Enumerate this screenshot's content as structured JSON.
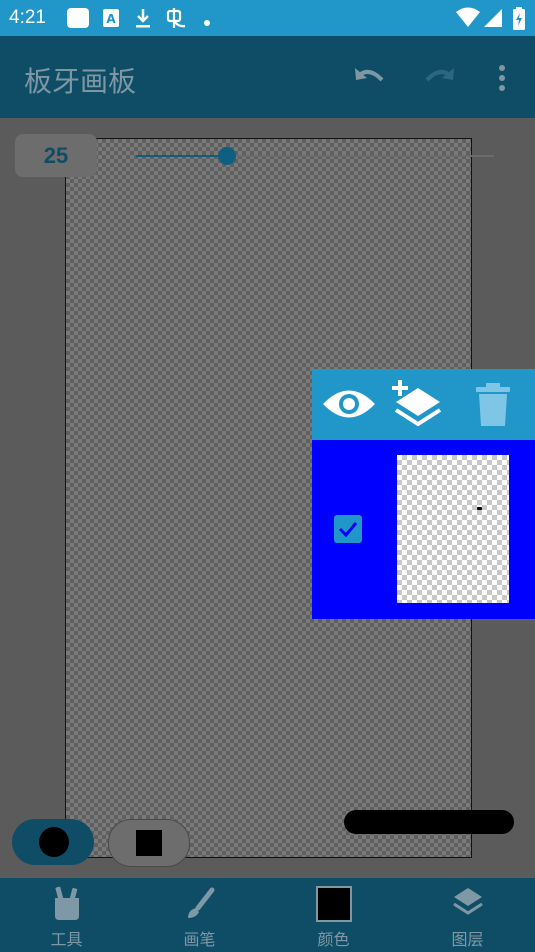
{
  "status_bar": {
    "time": "4:21",
    "icons": [
      "notification-square-icon",
      "font-a-icon",
      "download-icon",
      "bug-icon",
      "dot-icon",
      "wifi-icon",
      "signal-icon",
      "battery-icon"
    ]
  },
  "app_bar": {
    "title": "板牙画板",
    "actions": [
      "undo-icon",
      "redo-icon",
      "more-vert-icon"
    ]
  },
  "brush_size": {
    "value": "25",
    "slider_fraction": 0.255
  },
  "layer_panel": {
    "toolbar": [
      "eye-icon",
      "add-layer-icon",
      "trash-icon"
    ],
    "layers": [
      {
        "visible_checked": true
      }
    ]
  },
  "mode_toggles": [
    {
      "name": "fill-mode",
      "icon": "filled-circle-icon"
    },
    {
      "name": "stroke-mode",
      "icon": "filled-square-icon"
    }
  ],
  "bottom_nav": {
    "items": [
      {
        "label": "工具",
        "icon": "tools-icon"
      },
      {
        "label": "画笔",
        "icon": "brush-icon"
      },
      {
        "label": "颜色",
        "icon": "color-swatch-icon"
      },
      {
        "label": "图层",
        "icon": "layers-icon"
      }
    ]
  },
  "colors": {
    "status_bar": "#2196c9",
    "app_bar": "#0f4d66",
    "selected_layer": "#0000ff",
    "current_color": "#000000"
  }
}
